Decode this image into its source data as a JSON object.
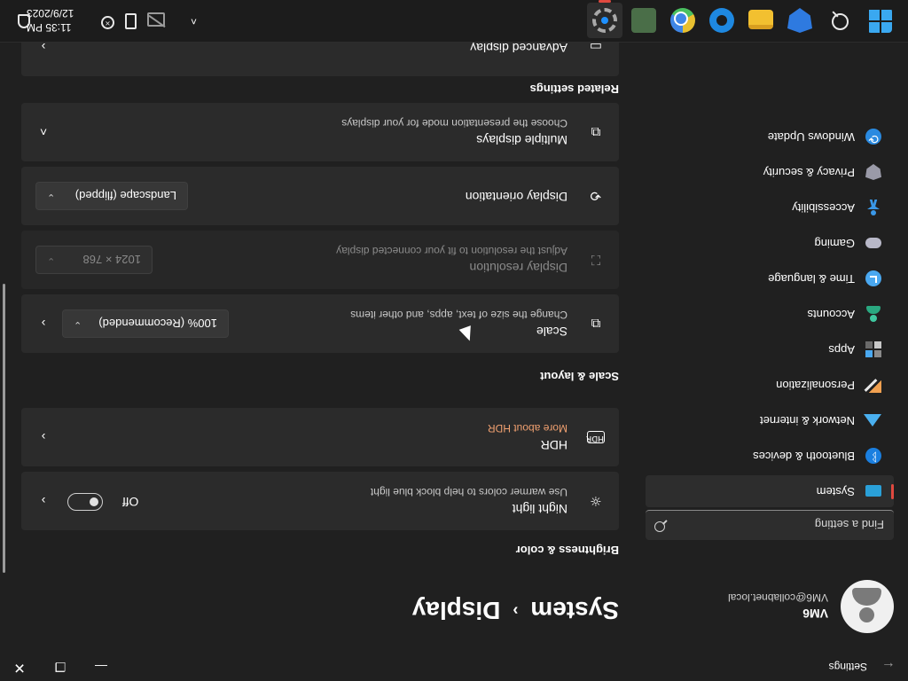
{
  "window": {
    "title": "Settings",
    "controls": {
      "minimize": "—",
      "maximize": "❐",
      "close": "✕"
    }
  },
  "profile": {
    "name": "VM6",
    "email": "VM6@collabnet.local"
  },
  "search": {
    "placeholder": "Find a setting"
  },
  "nav": {
    "items": [
      {
        "label": "System",
        "icon": "system-icon",
        "active": true
      },
      {
        "label": "Bluetooth & devices",
        "icon": "bluetooth-icon"
      },
      {
        "label": "Network & internet",
        "icon": "network-icon"
      },
      {
        "label": "Personalization",
        "icon": "brush-icon"
      },
      {
        "label": "Apps",
        "icon": "apps-icon"
      },
      {
        "label": "Accounts",
        "icon": "accounts-icon"
      },
      {
        "label": "Time & language",
        "icon": "clock-globe-icon"
      },
      {
        "label": "Gaming",
        "icon": "gamepad-icon"
      },
      {
        "label": "Accessibility",
        "icon": "accessibility-icon"
      },
      {
        "label": "Privacy & security",
        "icon": "shield-icon"
      },
      {
        "label": "Windows Update",
        "icon": "update-icon"
      }
    ]
  },
  "breadcrumb": {
    "parent": "System",
    "separator": "›",
    "current": "Display"
  },
  "sections": {
    "brightness": {
      "title": "Brightness & color",
      "night_light": {
        "title": "Night light",
        "subtitle": "Use warmer colors to help block blue light",
        "state_label": "Off",
        "state": false
      },
      "hdr": {
        "title": "HDR",
        "link": "More about HDR"
      }
    },
    "scale_layout": {
      "title": "Scale & layout",
      "scale": {
        "title": "Scale",
        "subtitle": "Change the size of text, apps, and other items",
        "value": "100% (Recommended)"
      },
      "resolution": {
        "title": "Display resolution",
        "subtitle": "Adjust the resolution to fit your connected display",
        "value": "1024 × 768",
        "disabled": true
      },
      "orientation": {
        "title": "Display orientation",
        "value": "Landscape (flipped)"
      },
      "multiple": {
        "title": "Multiple displays",
        "subtitle": "Choose the presentation mode for your displays"
      }
    },
    "related": {
      "title": "Related settings",
      "advanced": {
        "title": "Advanced display"
      }
    }
  },
  "glyphs": {
    "chevron_right": "›",
    "chevron_down": "⌄",
    "chevron_up": "˄",
    "caret": "⌄"
  },
  "taskbar": {
    "apps": [
      "start-button",
      "search-icon",
      "defender-pre-icon",
      "file-explorer-icon",
      "edge-icon",
      "chrome-icon",
      "remote-desktop-icon",
      "settings-icon"
    ],
    "time": "11:35 PM",
    "date": "12/9/2023"
  },
  "colors": {
    "accent": "#e0493f",
    "link": "#f0a070",
    "background": "#202020",
    "card": "#2b2b2b"
  }
}
